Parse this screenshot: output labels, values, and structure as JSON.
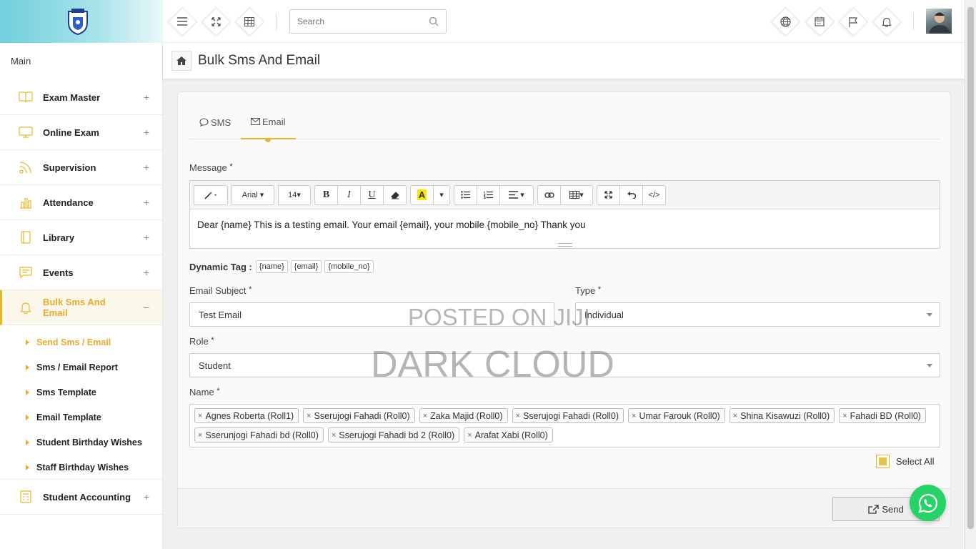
{
  "app": {
    "section_label": "Main"
  },
  "sidebar": {
    "items": [
      {
        "label": "Exam Master",
        "toggle": "+"
      },
      {
        "label": "Online Exam",
        "toggle": "+"
      },
      {
        "label": "Supervision",
        "toggle": "+"
      },
      {
        "label": "Attendance",
        "toggle": "+"
      },
      {
        "label": "Library",
        "toggle": "+"
      },
      {
        "label": "Events",
        "toggle": "+"
      },
      {
        "label": "Bulk Sms And Email",
        "toggle": "−"
      },
      {
        "label": "Student Accounting",
        "toggle": "+"
      }
    ],
    "submenu": [
      {
        "label": "Send Sms / Email"
      },
      {
        "label": "Sms / Email Report"
      },
      {
        "label": "Sms Template"
      },
      {
        "label": "Email Template"
      },
      {
        "label": "Student Birthday Wishes"
      },
      {
        "label": "Staff Birthday Wishes"
      }
    ]
  },
  "topbar": {
    "search_placeholder": "Search"
  },
  "page": {
    "title": "Bulk Sms And Email"
  },
  "tabs": [
    {
      "label": "SMS"
    },
    {
      "label": "Email"
    }
  ],
  "form": {
    "message_label": "Message",
    "required_mark": "*",
    "toolbar": {
      "font": "Arial",
      "size": "14",
      "bold": "B",
      "italic": "I",
      "underline": "U",
      "highlight": "A",
      "code": "</>"
    },
    "message_text": "Dear {name} This is a testing email. Your email {email}, your mobile {mobile_no} Thank you",
    "dynamic_tag_label": "Dynamic Tag :",
    "dynamic_tags": [
      "{name}",
      "{email}",
      "{mobile_no}"
    ],
    "subject_label": "Email Subject",
    "subject_value": "Test Email",
    "type_label": "Type",
    "type_value": "Individual",
    "role_label": "Role",
    "role_value": "Student",
    "name_label": "Name",
    "recipients": [
      "Agnes Roberta (Roll1)",
      "Sserujogi Fahadi (Roll0)",
      "Zaka Majid (Roll0)",
      "Sserujogi Fahadi (Roll0)",
      "Umar Farouk (Roll0)",
      "Shina Kisawuzi (Roll0)",
      "Fahadi BD (Roll0)",
      "Sserunjogi Fahadi bd (Roll0)",
      "Sserujogi Fahadi bd 2 (Roll0)",
      "Arafat Xabi (Roll0)"
    ],
    "chip_remove": "×",
    "select_all_label": "Select All",
    "select_all_checked": true,
    "send_label": "Send"
  },
  "watermark": {
    "line1": "POSTED ON JIJI",
    "line2": "DARK CLOUD"
  },
  "colors": {
    "accent": "#e9b62c",
    "whatsapp": "#25d366",
    "logo_gradient_start": "#6fd0dc"
  }
}
